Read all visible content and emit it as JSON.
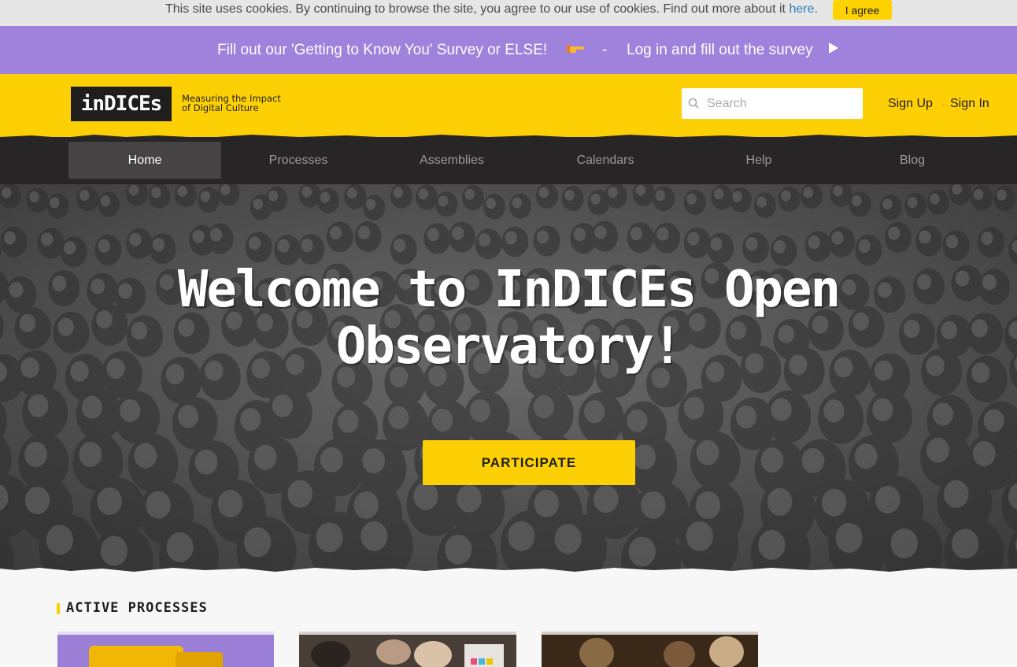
{
  "cookie_bar": {
    "text": "This site uses cookies. By continuing to browse the site, you agree to our use of cookies. Find out more about it",
    "link": "here",
    "period": ".",
    "agree_button": "I agree"
  },
  "survey_banner": {
    "left_text": "Fill out our 'Getting to Know You' Survey or ELSE!",
    "separator": "-",
    "right_text": "Log in and fill out the survey",
    "emoji_icon": "pointing-hand-icon",
    "arrow_icon": "play-triangle-icon"
  },
  "header": {
    "logo_text": "inDICEs",
    "tagline_line1": "Measuring the Impact",
    "tagline_line2": "of Digital Culture",
    "search_placeholder": "Search",
    "search_value": "",
    "sign_up": "Sign Up",
    "sign_in": "Sign In"
  },
  "nav": {
    "items": [
      "Home",
      "Processes",
      "Assemblies",
      "Calendars",
      "Help",
      "Blog"
    ],
    "active": "Home"
  },
  "hero": {
    "title": "Welcome to InDICEs Open Observatory!",
    "button": "PARTICIPATE"
  },
  "processes": {
    "title": "ACTIVE PROCESSES"
  },
  "colors": {
    "brand_yellow": "#fdd006",
    "survey_purple": "#9f82dc",
    "nav_dark": "#272525",
    "cookie_gray": "#e6e6e6"
  }
}
